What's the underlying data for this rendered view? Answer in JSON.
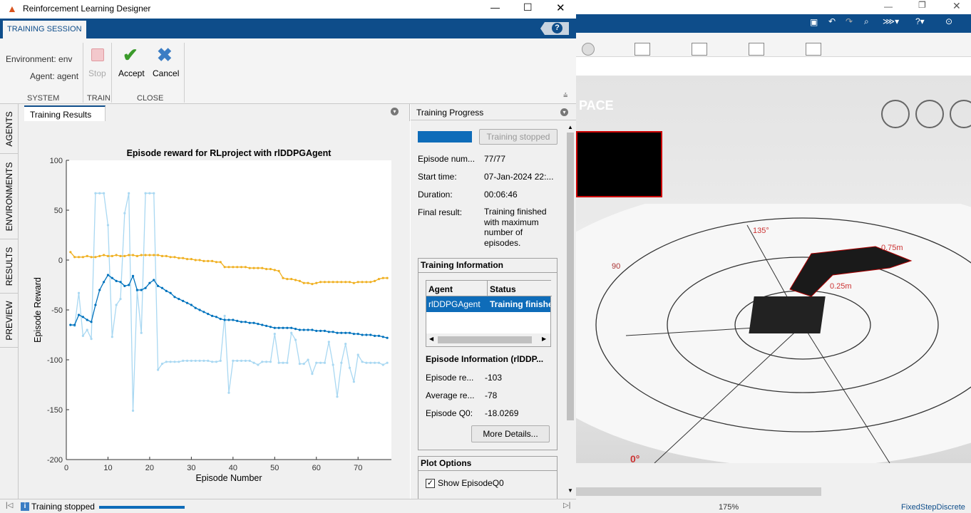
{
  "window": {
    "title": "Reinforcement Learning Designer",
    "help": "?"
  },
  "tabs": {
    "session": "TRAINING SESSION"
  },
  "ribbon": {
    "environment_label": "Environment: env",
    "agent_label": "Agent: agent",
    "stop_label": "Stop",
    "accept_label": "Accept",
    "cancel_label": "Cancel",
    "groups": {
      "system": "SYSTEM",
      "train": "TRAIN",
      "close": "CLOSE"
    }
  },
  "side_tabs": [
    "AGENTS",
    "ENVIRONMENTS",
    "RESULTS",
    "PREVIEW"
  ],
  "results": {
    "tab_label": "Training Results"
  },
  "chart_data": {
    "type": "line",
    "title": "Episode reward for RLproject with rlDDPGAgent",
    "xlabel": "Episode Number",
    "ylabel": "Episode Reward",
    "xlim": [
      0,
      78
    ],
    "ylim": [
      -200,
      100
    ],
    "xticks": [
      "0",
      "10",
      "20",
      "30",
      "40",
      "50",
      "60",
      "70"
    ],
    "yticks": [
      "100",
      "50",
      "0",
      "-50",
      "-100",
      "-150",
      "-200"
    ],
    "grid": false,
    "x": [
      1,
      2,
      3,
      4,
      5,
      6,
      7,
      8,
      9,
      10,
      11,
      12,
      13,
      14,
      15,
      16,
      17,
      18,
      19,
      20,
      21,
      22,
      23,
      24,
      25,
      26,
      27,
      28,
      29,
      30,
      31,
      32,
      33,
      34,
      35,
      36,
      37,
      38,
      39,
      40,
      41,
      42,
      43,
      44,
      45,
      46,
      47,
      48,
      49,
      50,
      51,
      52,
      53,
      54,
      55,
      56,
      57,
      58,
      59,
      60,
      61,
      62,
      63,
      64,
      65,
      66,
      67,
      68,
      69,
      70,
      71,
      72,
      73,
      74,
      75,
      76,
      77
    ],
    "series": [
      {
        "color": "#a9d8f2",
        "values": [
          -65,
          -66,
          -33,
          -76,
          -70,
          -79,
          67,
          67,
          67,
          35,
          -77,
          -45,
          -39,
          47,
          67,
          -151,
          -31,
          -73,
          67,
          67,
          67,
          -110,
          -104,
          -102,
          -102,
          -102,
          -102,
          -101,
          -101,
          -101,
          -101,
          -101,
          -101,
          -101,
          -102,
          -102,
          -101,
          -56,
          -133,
          -101,
          -101,
          -101,
          -101,
          -101,
          -103,
          -105,
          -102,
          -102,
          -102,
          -74,
          -103,
          -103,
          -103,
          -73,
          -80,
          -104,
          -104,
          -100,
          -114,
          -103,
          -103,
          -103,
          -82,
          -105,
          -137,
          -103,
          -84,
          -108,
          -122,
          -95,
          -102,
          -103,
          -103,
          -103,
          -103,
          -105,
          -103
        ]
      },
      {
        "color": "#f0b021",
        "values": [
          8,
          3,
          3,
          3,
          4,
          3,
          3,
          4,
          5,
          4,
          4,
          5,
          4,
          4,
          5,
          5,
          4,
          5,
          5,
          5,
          5,
          5,
          4,
          4,
          3,
          3,
          2,
          2,
          1,
          1,
          0,
          0,
          -1,
          -1,
          -1,
          -2,
          -2,
          -7,
          -7,
          -7,
          -7,
          -7,
          -7,
          -8,
          -8,
          -8,
          -8,
          -9,
          -9,
          -10,
          -11,
          -18,
          -19,
          -19,
          -20,
          -21,
          -23,
          -23,
          -24,
          -23,
          -22,
          -22,
          -22,
          -22,
          -22,
          -22,
          -22,
          -22,
          -23,
          -22,
          -22,
          -22,
          -22,
          -21,
          -19,
          -18,
          -18
        ]
      },
      {
        "color": "#0072bd",
        "values": [
          -65,
          -65,
          -55,
          -57,
          -60,
          -62,
          -45,
          -30,
          -22,
          -15,
          -18,
          -21,
          -22,
          -26,
          -25,
          -16,
          -30,
          -30,
          -28,
          -23,
          -20,
          -26,
          -28,
          -31,
          -33,
          -37,
          -39,
          -41,
          -43,
          -45,
          -48,
          -50,
          -52,
          -54,
          -56,
          -57,
          -59,
          -60,
          -60,
          -60,
          -61,
          -62,
          -62,
          -63,
          -63,
          -64,
          -65,
          -66,
          -67,
          -68,
          -68,
          -68,
          -68,
          -68,
          -69,
          -70,
          -70,
          -70,
          -70,
          -71,
          -71,
          -71,
          -72,
          -72,
          -73,
          -73,
          -73,
          -73,
          -74,
          -74,
          -75,
          -75,
          -75,
          -76,
          -76,
          -77,
          -78
        ]
      }
    ]
  },
  "progress": {
    "panel_title": "Training Progress",
    "button": "Training stopped",
    "fields": [
      {
        "label": "Episode num...",
        "value": "77/77"
      },
      {
        "label": "Start time:",
        "value": "07-Jan-2024 22:..."
      },
      {
        "label": "Duration:",
        "value": "00:06:46"
      },
      {
        "label": "Final result:",
        "value": "Training finished with maximum number of episodes."
      }
    ],
    "training_info_title": "Training Information",
    "table_headers": [
      "Agent",
      "Status"
    ],
    "table_row": [
      "rlDDPGAgent",
      "Training finished"
    ],
    "episode_info_title": "Episode Information (rlDDP...",
    "episode_fields": [
      {
        "label": "Episode re...",
        "value": "-103"
      },
      {
        "label": "Average re...",
        "value": "-78"
      },
      {
        "label": "Episode Q0:",
        "value": "-18.0269"
      }
    ],
    "more_details": "More Details...",
    "plot_options_title": "Plot Options",
    "show_q0": "Show EpisodeQ0"
  },
  "status": {
    "text": "Training stopped"
  },
  "background": {
    "header_text": "PACE",
    "labels": [
      "135°",
      "90",
      "0.75m",
      "0.25m",
      "0°"
    ],
    "zoom": "175%",
    "solver": "FixedStepDiscrete"
  }
}
